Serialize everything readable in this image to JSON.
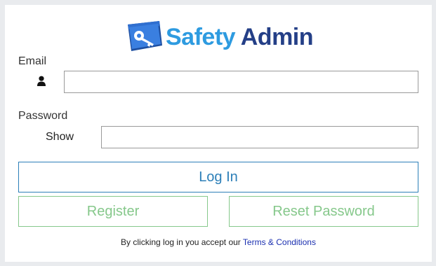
{
  "logo": {
    "name": "logo-image",
    "word1": "Safety",
    "word2": "Admin",
    "colors": {
      "word1": "#2e9be0",
      "word2": "#243f87"
    }
  },
  "form": {
    "email_label": "Email",
    "email_value": "",
    "email_icon": "user-icon",
    "password_label": "Password",
    "password_value": "",
    "show_label": "Show"
  },
  "buttons": {
    "login": "Log In",
    "register": "Register",
    "reset": "Reset Password"
  },
  "terms": {
    "prefix": "By clicking log in you accept our ",
    "link": "Terms & Conditions"
  },
  "colors": {
    "primary": "#2c7fb8",
    "secondary": "#86c88b",
    "link": "#1a2fb0"
  }
}
